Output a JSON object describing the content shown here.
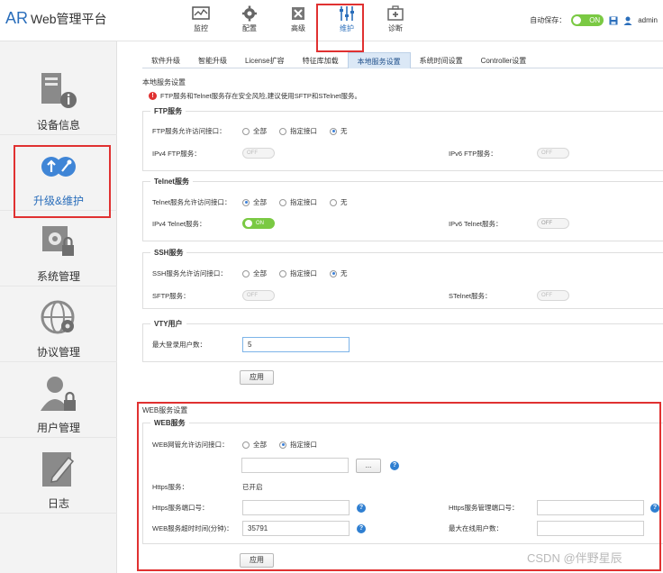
{
  "app": {
    "logo_main": "AR",
    "logo_sub": "Web管理平台"
  },
  "topnav": [
    {
      "label": "监控",
      "icon": "monitor-icon"
    },
    {
      "label": "配置",
      "icon": "gear-icon"
    },
    {
      "label": "高级",
      "icon": "tools-icon"
    },
    {
      "label": "维护",
      "icon": "sliders-icon"
    },
    {
      "label": "诊断",
      "icon": "medkit-icon"
    }
  ],
  "header_right": {
    "autosave_label": "自动保存：",
    "autosave_state": "ON",
    "user": "admin"
  },
  "sidebar": [
    {
      "label": "设备信息",
      "icon": "device-info-icon"
    },
    {
      "label": "升级&维护",
      "icon": "upgrade-maintain-icon"
    },
    {
      "label": "系统管理",
      "icon": "system-manage-icon"
    },
    {
      "label": "协议管理",
      "icon": "protocol-manage-icon"
    },
    {
      "label": "用户管理",
      "icon": "user-manage-icon"
    },
    {
      "label": "日志",
      "icon": "log-icon"
    }
  ],
  "tabs": [
    "软件升级",
    "智能升级",
    "License扩容",
    "特征库加载",
    "本地服务设置",
    "系统时间设置",
    "Controller设置"
  ],
  "local": {
    "title": "本地服务设置",
    "warning": "FTP服务和Telnet服务存在安全风险,建议使用SFTP和STelnet服务。"
  },
  "ftp": {
    "legend": "FTP服务",
    "access_label": "FTP服务允许访问接口：",
    "opt_all": "全部",
    "opt_specific": "指定接口",
    "opt_none": "无",
    "ipv4_label": "IPv4 FTP服务：",
    "ipv4_state": "OFF",
    "ipv6_label": "IPv6 FTP服务：",
    "ipv6_state": "OFF"
  },
  "telnet": {
    "legend": "Telnet服务",
    "access_label": "Telnet服务允许访问接口：",
    "opt_all": "全部",
    "opt_specific": "指定接口",
    "opt_none": "无",
    "ipv4_label": "IPv4 Telnet服务：",
    "ipv4_state": "ON",
    "ipv6_label": "IPv6 Telnet服务：",
    "ipv6_state": "OFF"
  },
  "ssh": {
    "legend": "SSH服务",
    "access_label": "SSH服务允许访问接口：",
    "opt_all": "全部",
    "opt_specific": "指定接口",
    "opt_none": "无",
    "sftp_label": "SFTP服务：",
    "sftp_state": "OFF",
    "stelnet_label": "STelnet服务：",
    "stelnet_state": "OFF"
  },
  "vty": {
    "legend": "VTY用户",
    "max_label": "最大登录用户数：",
    "max_value": "5"
  },
  "apply_label": "应用",
  "web": {
    "title": "WEB服务设置",
    "legend": "WEB服务",
    "access_label": "WEB网管允许访问接口：",
    "opt_all": "全部",
    "opt_specific": "指定接口",
    "browse_label": "...",
    "https_label": "Https服务：",
    "https_state": "已开启",
    "https_port_label": "Https服务端口号：",
    "https_mgmt_port_label": "Https服务管理端口号：",
    "timeout_label": "WEB服务超时时间(分钟)：",
    "timeout_value": "35791",
    "max_online_label": "最大在线用户数："
  },
  "watermark": "CSDN @伴野星辰"
}
